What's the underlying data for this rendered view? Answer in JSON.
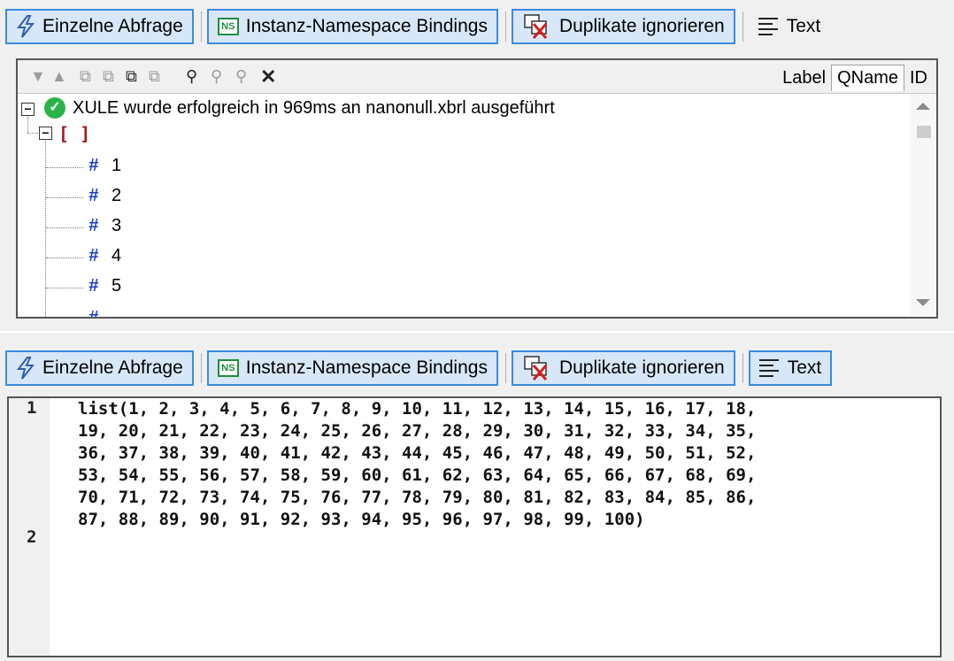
{
  "top_toolbar": {
    "query_label": "Einzelne Abfrage",
    "ns_label": "Instanz-Namespace Bindings",
    "ns_icon": "NS",
    "dup_label": "Duplikate ignorieren",
    "text_label": "Text"
  },
  "tree_toolbar": {
    "tabs": [
      "Label",
      "QName",
      "ID"
    ],
    "selected_tab": "QName"
  },
  "tree": {
    "status_text": "XULE wurde erfolgreich in 969ms an nanonull.xbrl ausgeführt",
    "list_symbol": "[ ]",
    "items": [
      "1",
      "2",
      "3",
      "4",
      "5"
    ],
    "hash": "#"
  },
  "bottom_toolbar": {
    "query_label": "Einzelne Abfrage",
    "ns_label": "Instanz-Namespace Bindings",
    "ns_icon": "NS",
    "dup_label": "Duplikate ignorieren",
    "text_label": "Text"
  },
  "editor": {
    "line_numbers": [
      "1",
      "2"
    ],
    "code": "list(1, 2, 3, 4, 5, 6, 7, 8, 9, 10, 11, 12, 13, 14, 15, 16, 17, 18,\n19, 20, 21, 22, 23, 24, 25, 26, 27, 28, 29, 30, 31, 32, 33, 34, 35,\n36, 37, 38, 39, 40, 41, 42, 43, 44, 45, 46, 47, 48, 49, 50, 51, 52,\n53, 54, 55, 56, 57, 58, 59, 60, 61, 62, 63, 64, 65, 66, 67, 68, 69,\n70, 71, 72, 73, 74, 75, 76, 77, 78, 79, 80, 81, 82, 83, 84, 85, 86,\n87, 88, 89, 90, 91, 92, 93, 94, 95, 96, 97, 98, 99, 100)"
  },
  "colors": {
    "active_button_bg": "#d7e7f7",
    "active_button_border": "#3c8be0",
    "success": "#29b44a",
    "bracket": "#a01a1a",
    "hash": "#1a3fd0"
  }
}
